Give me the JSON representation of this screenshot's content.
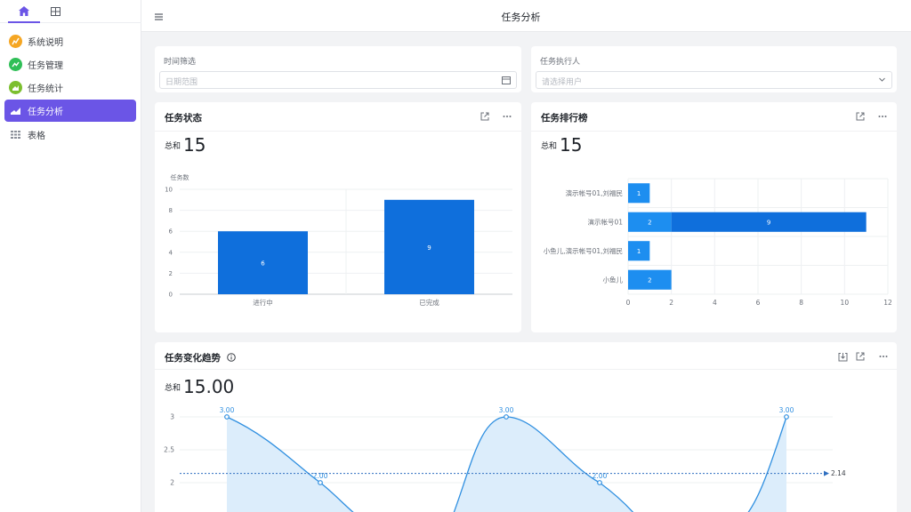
{
  "header": {
    "title": "任务分析"
  },
  "sidebar": {
    "items": [
      {
        "label": "系统说明",
        "color": "#f5a623"
      },
      {
        "label": "任务管理",
        "color": "#2fbf57"
      },
      {
        "label": "任务统计",
        "color": "#7cbf2f"
      },
      {
        "label": "任务分析",
        "color": "#6b55e6",
        "active": true
      },
      {
        "label": "表格",
        "color": "#8a8f99"
      }
    ]
  },
  "filters": {
    "time": {
      "label": "时间筛选",
      "placeholder": "日期范围"
    },
    "executor": {
      "label": "任务执行人",
      "placeholder": "请选择用户"
    }
  },
  "status_card": {
    "title": "任务状态",
    "total_label": "总和",
    "total": "15"
  },
  "ranking_card": {
    "title": "任务排行榜",
    "total_label": "总和",
    "total": "15"
  },
  "trend_card": {
    "title": "任务变化趋势",
    "total_label": "总和",
    "total": "15.00"
  },
  "chart_data": [
    {
      "type": "bar",
      "title": "任务状态",
      "ylabel": "任务数",
      "categories": [
        "进行中",
        "已完成"
      ],
      "values": [
        6,
        9
      ],
      "ylim": [
        0,
        10
      ],
      "yticks": [
        0,
        2,
        4,
        6,
        8,
        10
      ],
      "color": "#0f6fdc",
      "grid": true
    },
    {
      "type": "bar",
      "orientation": "horizontal",
      "stacked": true,
      "title": "任务排行榜",
      "categories": [
        "演示帐号01,刘福民",
        "演示帐号01",
        "小鱼儿,演示帐号01,刘福民",
        "小鱼儿"
      ],
      "series": [
        {
          "values": [
            1,
            2,
            1,
            2
          ],
          "color": "#1d8ef0"
        },
        {
          "values": [
            0,
            9,
            0,
            0
          ],
          "color": "#0f6fdc"
        }
      ],
      "xlim": [
        0,
        12
      ],
      "xticks": [
        0,
        2,
        4,
        6,
        8,
        10,
        12
      ],
      "grid": true
    },
    {
      "type": "area",
      "title": "任务变化趋势",
      "values": [
        3.0,
        2.0,
        null,
        null,
        3.0,
        2.0,
        null,
        3.0
      ],
      "value_labels": [
        "3.00",
        "2.00",
        "",
        "",
        "3.00",
        "2.00",
        "",
        "3.00"
      ],
      "visible_y_range": [
        1.65,
        3.2
      ],
      "yticks": [
        2,
        2.5,
        3
      ],
      "average": 2.14,
      "average_label": "2.14",
      "color": "#2f8fe0"
    }
  ]
}
